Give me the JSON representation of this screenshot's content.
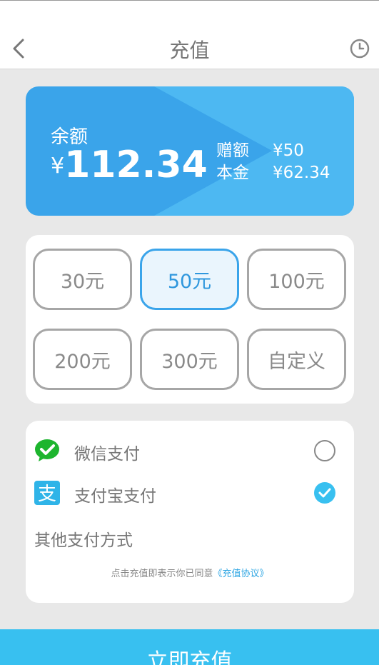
{
  "header": {
    "title": "充值",
    "back_icon": "chevron-left-icon",
    "history_icon": "clock-icon"
  },
  "balance": {
    "label": "余额",
    "currency": "¥",
    "amount": "112.34",
    "bonus_label": "赠额",
    "bonus_value": "¥50",
    "principal_label": "本金",
    "principal_value": "¥62.34",
    "colors": {
      "card": "#3aa4ea",
      "card_light": "#4db8f2"
    }
  },
  "amount_options": [
    {
      "label": "30元",
      "selected": false
    },
    {
      "label": "50元",
      "selected": true
    },
    {
      "label": "100元",
      "selected": false
    },
    {
      "label": "200元",
      "selected": false
    },
    {
      "label": "300元",
      "selected": false
    },
    {
      "label": "自定义",
      "selected": false
    }
  ],
  "payment": {
    "methods": [
      {
        "label": "微信支付",
        "icon": "wechat-pay-icon",
        "selected": false,
        "color": "#1db52e"
      },
      {
        "label": "支付宝支付",
        "icon": "alipay-icon",
        "selected": true,
        "color": "#2fb4e8"
      }
    ],
    "other_label": "其他支付方式",
    "agreement_text": "点击充值即表示你已同意",
    "agreement_link": "《充值协议》"
  },
  "submit_label": "立即充值",
  "colors": {
    "accent": "#38c0f0",
    "selected_border": "#3aa4ea"
  }
}
